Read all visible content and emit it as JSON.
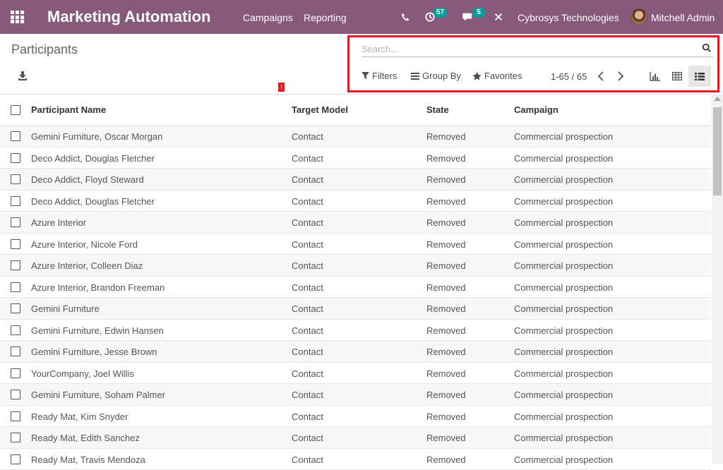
{
  "app": {
    "title": "Marketing Automation",
    "menus": [
      "Campaigns",
      "Reporting"
    ],
    "activity_count": "57",
    "message_count": "5",
    "company": "Cybrosys Technologies",
    "user": "Mitchell Admin"
  },
  "breadcrumb": "Participants",
  "search": {
    "placeholder": "Search...",
    "value": ""
  },
  "filters": {
    "filters_label": "Filters",
    "groupby_label": "Group By",
    "favorites_label": "Favorites"
  },
  "pager": {
    "range": "1-65 / 65"
  },
  "table": {
    "headers": [
      "Participant Name",
      "Target Model",
      "State",
      "Campaign"
    ],
    "rows": [
      [
        "Gemini Furniture, Oscar Morgan",
        "Contact",
        "Removed",
        "Commercial prospection"
      ],
      [
        "Deco Addict, Douglas Fletcher",
        "Contact",
        "Removed",
        "Commercial prospection"
      ],
      [
        "Deco Addict, Floyd Steward",
        "Contact",
        "Removed",
        "Commercial prospection"
      ],
      [
        "Deco Addict, Douglas Fletcher",
        "Contact",
        "Removed",
        "Commercial prospection"
      ],
      [
        "Azure Interior",
        "Contact",
        "Removed",
        "Commercial prospection"
      ],
      [
        "Azure Interior, Nicole Ford",
        "Contact",
        "Removed",
        "Commercial prospection"
      ],
      [
        "Azure Interior, Colleen Diaz",
        "Contact",
        "Removed",
        "Commercial prospection"
      ],
      [
        "Azure Interior, Brandon Freeman",
        "Contact",
        "Removed",
        "Commercial prospection"
      ],
      [
        "Gemini Furniture",
        "Contact",
        "Removed",
        "Commercial prospection"
      ],
      [
        "Gemini Furniture, Edwin Hansen",
        "Contact",
        "Removed",
        "Commercial prospection"
      ],
      [
        "Gemini Furniture, Jesse Brown",
        "Contact",
        "Removed",
        "Commercial prospection"
      ],
      [
        "YourCompany, Joel Willis",
        "Contact",
        "Removed",
        "Commercial prospection"
      ],
      [
        "Gemini Furniture, Soham Palmer",
        "Contact",
        "Removed",
        "Commercial prospection"
      ],
      [
        "Ready Mat, Kim Snyder",
        "Contact",
        "Removed",
        "Commercial prospection"
      ],
      [
        "Ready Mat, Edith Sanchez",
        "Contact",
        "Removed",
        "Commercial prospection"
      ],
      [
        "Ready Mat, Travis Mendoza",
        "Contact",
        "Removed",
        "Commercial prospection"
      ]
    ]
  },
  "colors": {
    "navbar": "#875a7b",
    "badge": "#00a09d",
    "highlight": "#e01b24"
  }
}
